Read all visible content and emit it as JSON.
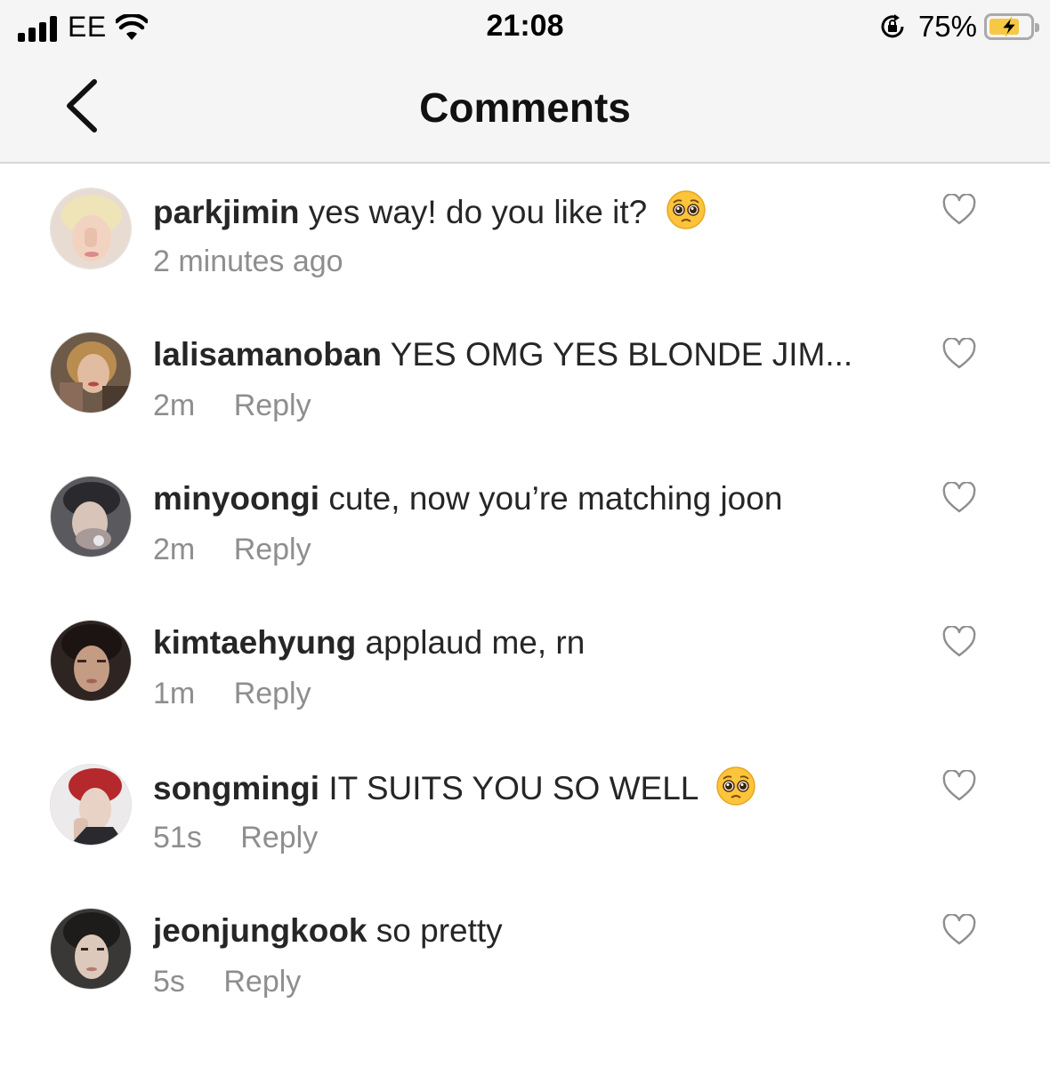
{
  "status_bar": {
    "carrier": "EE",
    "time": "21:08",
    "battery_percent": "75%",
    "battery_level": 0.75,
    "icons": [
      "signal-icon",
      "wifi-icon",
      "orientation-lock-icon",
      "battery-charging-icon"
    ]
  },
  "nav": {
    "title": "Comments",
    "back_icon": "chevron-left-icon"
  },
  "comments": [
    {
      "username": "parkjimin",
      "text": "yes way! do you like it?",
      "emoji": "pleading-face",
      "meta": "2 minutes ago",
      "reply": ""
    },
    {
      "username": "lalisamanoban",
      "text": "YES OMG YES BLONDE JIM...",
      "emoji": "",
      "meta": "2m",
      "reply": "Reply"
    },
    {
      "username": "minyoongi",
      "text": "cute, now you’re matching joon",
      "emoji": "",
      "meta": "2m",
      "reply": "Reply"
    },
    {
      "username": "kimtaehyung",
      "text": "applaud me, rn",
      "emoji": "",
      "meta": "1m",
      "reply": "Reply"
    },
    {
      "username": "songmingi",
      "text": "IT SUITS YOU SO WELL",
      "emoji": "pleading-face",
      "meta": "51s",
      "reply": "Reply"
    },
    {
      "username": "jeonjungkook",
      "text": "so pretty",
      "emoji": "",
      "meta": "5s",
      "reply": "Reply"
    }
  ],
  "colors": {
    "header_bg": "#f5f5f5",
    "text": "#262626",
    "meta_text": "#8e8e8e",
    "battery_fill": "#f7c843"
  }
}
